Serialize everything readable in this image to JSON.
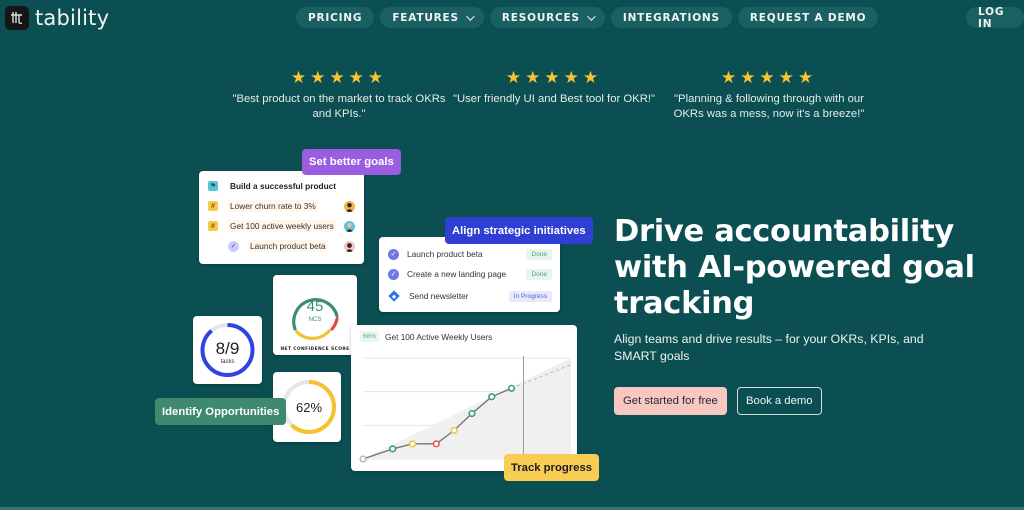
{
  "brand": {
    "name": "tability"
  },
  "nav": {
    "items": [
      {
        "label": "PRICING",
        "has_dropdown": false
      },
      {
        "label": "FEATURES",
        "has_dropdown": true
      },
      {
        "label": "RESOURCES",
        "has_dropdown": true
      },
      {
        "label": "INTEGRATIONS",
        "has_dropdown": false
      },
      {
        "label": "REQUEST A DEMO",
        "has_dropdown": false
      }
    ],
    "login": "LOG IN"
  },
  "testimonials": [
    {
      "stars": "★★★★★",
      "rating": 5,
      "quote": "\"Best product on the market to track OKRs and KPIs.\""
    },
    {
      "stars": "★★★★★",
      "rating": 5,
      "quote": "\"User friendly UI and Best tool for OKR!\""
    },
    {
      "stars": "★★★★★",
      "rating": 5,
      "quote": "\"Planning & following through with our OKRs was a mess, now it's a breeze!\""
    }
  ],
  "illustration": {
    "tags": {
      "set_goals": "Set better goals",
      "align": "Align strategic initiatives",
      "identify": "Identify Opportunities",
      "track": "Track progress"
    },
    "tag_colors": {
      "set_goals": "#9b5de0",
      "align": "#2f3fd4",
      "identify": "#3e8a6e",
      "track": "#f8cd54"
    },
    "goals": [
      {
        "icon": "flag-icon",
        "label": "Build a successful product",
        "avatar": null
      },
      {
        "icon": "hash-icon",
        "label": "Lower churn rate to 3%",
        "avatar": "avatar-1"
      },
      {
        "icon": "hash-icon",
        "label": "Get 100 active weekly users",
        "avatar": "avatar-2"
      },
      {
        "icon": "check-icon",
        "label": "Launch product beta",
        "avatar": "avatar-3"
      }
    ],
    "initiatives": [
      {
        "icon": "check-icon",
        "label": "Launch product beta",
        "status": "Done"
      },
      {
        "icon": "check-icon",
        "label": "Create a new landing page",
        "status": "Done"
      },
      {
        "icon": "jira-icon",
        "label": "Send newsletter",
        "status": "In Progress"
      }
    ],
    "ncs": {
      "value": "45",
      "unit": "NCS",
      "caption": "NET CONFIDENCE SCORE"
    },
    "tasks": {
      "value": "8/9",
      "caption": "tasks",
      "done": 8,
      "total": 9
    },
    "percent": {
      "value": "62%",
      "fraction": 0.62
    },
    "progress_chart": {
      "badge": "68%",
      "title": "Get 100 Active Weekly Users"
    }
  },
  "chart_data": {
    "type": "line",
    "title": "Get 100 Active Weekly Users",
    "badge": "68%",
    "points": [
      {
        "x": 0,
        "y": 0,
        "status": "none"
      },
      {
        "x": 1.5,
        "y": 0.3,
        "status": "on-track"
      },
      {
        "x": 2.5,
        "y": 0.45,
        "status": "at-risk"
      },
      {
        "x": 3.7,
        "y": 0.45,
        "status": "off-track"
      },
      {
        "x": 4.6,
        "y": 0.85,
        "status": "at-risk"
      },
      {
        "x": 5.5,
        "y": 1.35,
        "status": "on-track"
      },
      {
        "x": 6.5,
        "y": 1.85,
        "status": "on-track"
      },
      {
        "x": 7.5,
        "y": 2.1,
        "status": "on-track"
      }
    ],
    "forecast": [
      {
        "x": 7.5,
        "y": 2.1
      },
      {
        "x": 10.5,
        "y": 2.8
      }
    ],
    "target_band": [
      {
        "x": 0,
        "y": 0
      },
      {
        "x": 10.5,
        "y": 3.0
      }
    ],
    "today_x": 8.1,
    "xlim": [
      0,
      10.5
    ],
    "ylim": [
      0,
      3
    ],
    "grid": true,
    "status_colors": {
      "none": "#b9b9b9",
      "on-track": "#3f9c74",
      "at-risk": "#f2c43c",
      "off-track": "#ea5a47"
    }
  },
  "hero": {
    "title": "Drive accountability with AI-powered goal tracking",
    "subtitle": "Align teams and drive results – for your OKRs, KPIs, and SMART goals",
    "primary_cta": "Get started for free",
    "secondary_cta": "Book a demo"
  }
}
